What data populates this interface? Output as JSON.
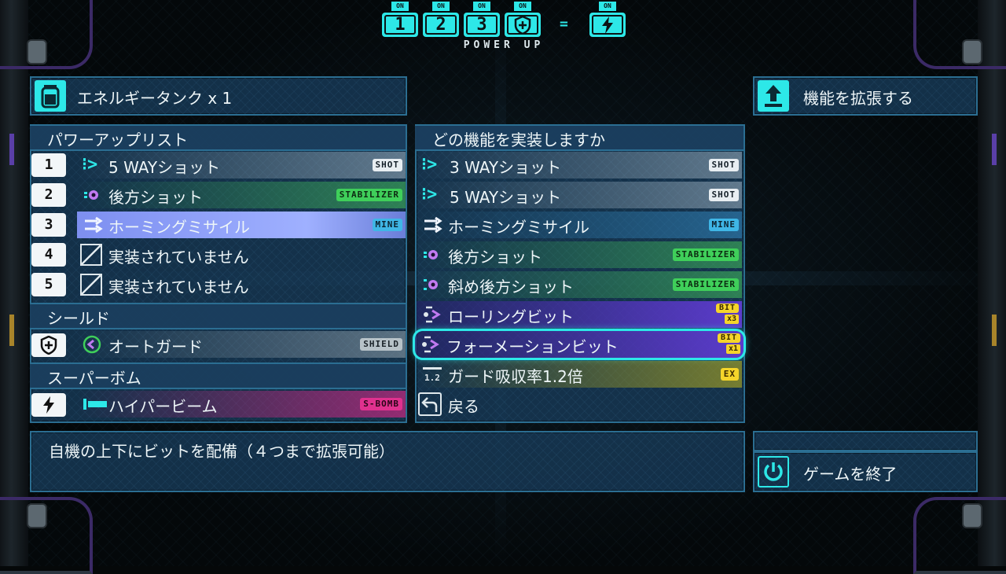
{
  "power_up": {
    "title": "POWER UP",
    "slots": [
      {
        "on": "ON",
        "symbol": "1"
      },
      {
        "on": "ON",
        "symbol": "2"
      },
      {
        "on": "ON",
        "symbol": "3"
      },
      {
        "on": "ON",
        "symbol": "shield-icon"
      },
      {
        "on": "ON",
        "symbol": "bolt-icon"
      }
    ],
    "equals": "="
  },
  "energy_tank": {
    "label": "エネルギータンク x 1"
  },
  "expand_button": {
    "label": "機能を拡張する"
  },
  "quit_button": {
    "label": "ゲームを終了"
  },
  "power_list": {
    "header": "パワーアップリスト",
    "items": [
      {
        "num": "1",
        "label": "5 WAYショット",
        "tag": "SHOT"
      },
      {
        "num": "2",
        "label": "後方ショット",
        "tag": "STABILIZER"
      },
      {
        "num": "3",
        "label": "ホーミングミサイル",
        "tag": "MINE"
      },
      {
        "num": "4",
        "label": "実装されていません",
        "tag": ""
      },
      {
        "num": "5",
        "label": "実装されていません",
        "tag": ""
      }
    ]
  },
  "shield": {
    "header": "シールド",
    "label": "オートガード",
    "tag": "SHIELD"
  },
  "super_bomb": {
    "header": "スーパーボム",
    "label": "ハイパービーム",
    "tag": "S-BOMB"
  },
  "choose": {
    "header": "どの機能を実装しますか",
    "items": [
      {
        "label": "3 WAYショット",
        "tag": "SHOT"
      },
      {
        "label": "5 WAYショット",
        "tag": "SHOT"
      },
      {
        "label": "ホーミングミサイル",
        "tag": "MINE"
      },
      {
        "label": "後方ショット",
        "tag": "STABILIZER"
      },
      {
        "label": "斜め後方ショット",
        "tag": "STABILIZER"
      },
      {
        "label": "ローリングビット",
        "tag": "BIT",
        "mult": "x3"
      },
      {
        "label": "フォーメーションビット",
        "tag": "BIT",
        "mult": "x1",
        "selected": true
      },
      {
        "label": "ガード吸収率1.2倍",
        "tag": "EX"
      },
      {
        "label": "戻る",
        "tag": ""
      }
    ]
  },
  "description": "自機の上下にビットを配備（４つまで拡張可能）",
  "colors": {
    "accent": "#2de8e8",
    "panel": "#163754",
    "border": "#2b6e92"
  }
}
